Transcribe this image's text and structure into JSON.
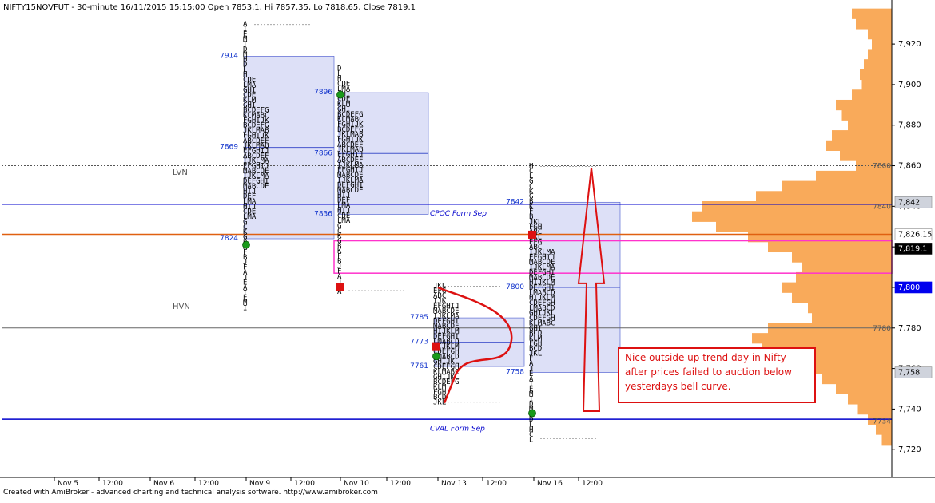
{
  "title": "NIFTY15NOVFUT - 30-minute 16/11/2015 15:15:00 Open 7853.1, Hi 7857.35, Lo 7818.65, Close 7819.1",
  "footer": "Created with AmiBroker - advanced charting and technical analysis software. http://www.amibroker.com",
  "colors": {
    "value_area": "#dde0f7",
    "value_area_border": "#4455cc",
    "volume_profile": "#f9aa5a",
    "blue_line": "#0000cc",
    "orange_line": "#e06010",
    "magenta": "#ff33cc",
    "annotation_red": "#dd1111",
    "poc_label_blue": "#1133cc"
  },
  "chart_data": {
    "type": "market-profile",
    "ylim": [
      7713,
      7935
    ],
    "y_ticks": [
      "7,920",
      "7,900",
      "7,880",
      "7,860",
      "7,840",
      "7,820",
      "7,800",
      "7,780",
      "7,760",
      "7,740",
      "7,720"
    ],
    "x_ticks": [
      "Nov 5",
      "12:00",
      "Nov 6",
      "12:00",
      "Nov 9",
      "12:00",
      "Nov 10",
      "12:00",
      "Nov 13",
      "12:00",
      "Nov 16",
      "12:00"
    ],
    "price_tags": [
      {
        "text": "7,842",
        "y": 7842,
        "style": "grey"
      },
      {
        "text": "7,826.15",
        "y": 7826.15,
        "style": "white"
      },
      {
        "text": "7,819.1",
        "y": 7819.1,
        "style": "black"
      },
      {
        "text": "7,800",
        "y": 7800,
        "style": "blue"
      },
      {
        "text": "7,758",
        "y": 7758,
        "style": "grey"
      }
    ],
    "line_labels": [
      {
        "text": "7860",
        "y": 7860
      },
      {
        "text": "7840",
        "y": 7840
      },
      {
        "text": "7780",
        "y": 7780
      },
      {
        "text": "7734",
        "y": 7734
      }
    ],
    "horizontal_lines": [
      {
        "name": "lvn-line",
        "y": 7860,
        "style": "dotted-grey"
      },
      {
        "name": "cpoc-line",
        "y": 7841,
        "style": "blue"
      },
      {
        "name": "orange-line",
        "y": 7826.15,
        "style": "orange"
      },
      {
        "name": "hvn-line",
        "y": 7780,
        "style": "grey"
      },
      {
        "name": "cval-line",
        "y": 7735,
        "style": "blue"
      }
    ],
    "text_labels": [
      {
        "text": "LVN",
        "y": 7857
      },
      {
        "text": "HVN",
        "y": 7791
      },
      {
        "text": "CPOC Form Sep",
        "y": 7837
      },
      {
        "text": "CVAL Form Sep",
        "y": 7731
      }
    ],
    "annotation": "Nice outside up trend day in Nifty after prices failed to auction below yesterdays bell curve.",
    "sessions": [
      {
        "day": "Nov 9",
        "high": 7930,
        "low": 7790,
        "va_high": 7914,
        "va_low": 7824,
        "poc": 7869,
        "open_marker": 7821,
        "close_marker": null,
        "value_labels": [
          "7914",
          "7869",
          "7824"
        ]
      },
      {
        "day": "Nov 10",
        "high": 7908,
        "low": 7798,
        "va_high": 7896,
        "va_low": 7836,
        "poc": 7866,
        "open_marker": 7895,
        "close_marker": 7800,
        "value_labels": [
          "7896",
          "7866",
          "7836"
        ]
      },
      {
        "day": "Nov 13",
        "high": 7801,
        "low": 7743,
        "va_high": 7785,
        "va_low": 7761,
        "poc": 7773,
        "open_marker": 7766,
        "close_marker": 7771,
        "value_labels": [
          "7785",
          "7773",
          "7761"
        ]
      },
      {
        "day": "Nov 16",
        "high": 7860,
        "low": 7725,
        "va_high": 7842,
        "va_low": 7758,
        "poc": 7800,
        "open_marker": 7738,
        "close_marker": 7826,
        "value_labels": [
          "7842",
          "7800",
          "7758"
        ]
      }
    ],
    "volume_profile": [
      {
        "y": 7935,
        "v": 0.2
      },
      {
        "y": 7930,
        "v": 0.18
      },
      {
        "y": 7925,
        "v": 0.12
      },
      {
        "y": 7920,
        "v": 0.1
      },
      {
        "y": 7915,
        "v": 0.12
      },
      {
        "y": 7910,
        "v": 0.14
      },
      {
        "y": 7905,
        "v": 0.16
      },
      {
        "y": 7900,
        "v": 0.15
      },
      {
        "y": 7895,
        "v": 0.2
      },
      {
        "y": 7890,
        "v": 0.28
      },
      {
        "y": 7885,
        "v": 0.25
      },
      {
        "y": 7880,
        "v": 0.22
      },
      {
        "y": 7875,
        "v": 0.3
      },
      {
        "y": 7870,
        "v": 0.33
      },
      {
        "y": 7865,
        "v": 0.26
      },
      {
        "y": 7860,
        "v": 0.18
      },
      {
        "y": 7855,
        "v": 0.38
      },
      {
        "y": 7850,
        "v": 0.55
      },
      {
        "y": 7845,
        "v": 0.68
      },
      {
        "y": 7840,
        "v": 0.95
      },
      {
        "y": 7835,
        "v": 1.0
      },
      {
        "y": 7830,
        "v": 0.88
      },
      {
        "y": 7825,
        "v": 0.72
      },
      {
        "y": 7820,
        "v": 0.62
      },
      {
        "y": 7815,
        "v": 0.5
      },
      {
        "y": 7810,
        "v": 0.45
      },
      {
        "y": 7805,
        "v": 0.48
      },
      {
        "y": 7800,
        "v": 0.55
      },
      {
        "y": 7795,
        "v": 0.5
      },
      {
        "y": 7790,
        "v": 0.42
      },
      {
        "y": 7785,
        "v": 0.4
      },
      {
        "y": 7780,
        "v": 0.62
      },
      {
        "y": 7775,
        "v": 0.7
      },
      {
        "y": 7770,
        "v": 0.65
      },
      {
        "y": 7765,
        "v": 0.52
      },
      {
        "y": 7760,
        "v": 0.42
      },
      {
        "y": 7755,
        "v": 0.35
      },
      {
        "y": 7750,
        "v": 0.28
      },
      {
        "y": 7745,
        "v": 0.22
      },
      {
        "y": 7740,
        "v": 0.17
      },
      {
        "y": 7735,
        "v": 0.12
      },
      {
        "y": 7730,
        "v": 0.08
      },
      {
        "y": 7725,
        "v": 0.05
      }
    ]
  }
}
